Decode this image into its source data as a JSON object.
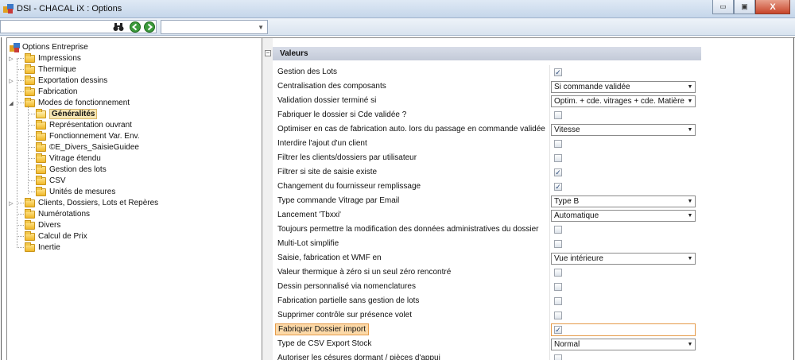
{
  "window": {
    "title": "DSI - CHACAL iX : Options",
    "minimize_glyph": "▭",
    "maximize_glyph": "▣",
    "close_glyph": "X"
  },
  "toolbar": {
    "icons": [
      "binoculars-icon",
      "back-icon",
      "forward-icon"
    ],
    "combo_value": ""
  },
  "tree": {
    "root": "Options Entreprise",
    "items": [
      {
        "label": "Impressions",
        "level": 1,
        "expander": true
      },
      {
        "label": "Thermique",
        "level": 1
      },
      {
        "label": "Exportation dessins",
        "level": 1,
        "expander": true
      },
      {
        "label": "Fabrication",
        "level": 1
      },
      {
        "label": "Modes de fonctionnement",
        "level": 1,
        "expanded": true
      },
      {
        "label": "Généralités",
        "level": 2,
        "selected": true
      },
      {
        "label": "Représentation ouvrant",
        "level": 2
      },
      {
        "label": "Fonctionnement Var. Env.",
        "level": 2
      },
      {
        "label": "©E_Divers_SaisieGuidee",
        "level": 2
      },
      {
        "label": "Vitrage étendu",
        "level": 2
      },
      {
        "label": "Gestion des lots",
        "level": 2
      },
      {
        "label": "CSV",
        "level": 2
      },
      {
        "label": "Unités de mesures",
        "level": 2
      },
      {
        "label": "Clients, Dossiers, Lots et Repères",
        "level": 1,
        "expander": true
      },
      {
        "label": "Numérotations",
        "level": 1
      },
      {
        "label": "Divers",
        "level": 1
      },
      {
        "label": "Calcul de Prix",
        "level": 1
      },
      {
        "label": "Inertie",
        "level": 1
      }
    ]
  },
  "grid": {
    "section_title": "Valeurs",
    "collapse_glyph": "−",
    "rows": [
      {
        "label": "Gestion des Lots",
        "type": "checkbox",
        "checked": true
      },
      {
        "label": "Centralisation des composants",
        "type": "dropdown",
        "value": "Si commande validée"
      },
      {
        "label": "Validation dossier terminé si",
        "type": "dropdown",
        "value": "Optim. + cde. vitrages + cde. Matière"
      },
      {
        "label": "Fabriquer le dossier si Cde validée ?",
        "type": "checkbox",
        "checked": false
      },
      {
        "label": "Optimiser en cas de fabrication auto. lors du passage en commande validée",
        "type": "dropdown",
        "value": "Vitesse"
      },
      {
        "label": "Interdire l'ajout d'un client",
        "type": "checkbox",
        "checked": false
      },
      {
        "label": "Filtrer les clients/dossiers par utilisateur",
        "type": "checkbox",
        "checked": false
      },
      {
        "label": "Filtrer si site de saisie existe",
        "type": "checkbox",
        "checked": true
      },
      {
        "label": "Changement du fournisseur remplissage",
        "type": "checkbox",
        "checked": true
      },
      {
        "label": "Type commande Vitrage par Email",
        "type": "dropdown",
        "value": "Type B"
      },
      {
        "label": "Lancement 'Tbxxi'",
        "type": "dropdown",
        "value": "Automatique"
      },
      {
        "label": "Toujours permettre la modification des données administratives du dossier",
        "type": "checkbox",
        "checked": false
      },
      {
        "label": "Multi-Lot simplifie",
        "type": "checkbox",
        "checked": false
      },
      {
        "label": "Saisie, fabrication et WMF en",
        "type": "dropdown",
        "value": "Vue intérieure"
      },
      {
        "label": "Valeur thermique à zéro si un seul zéro rencontré",
        "type": "checkbox",
        "checked": false
      },
      {
        "label": "Dessin personnalisé via nomenclatures",
        "type": "checkbox",
        "checked": false
      },
      {
        "label": "Fabrication partielle sans gestion de lots",
        "type": "checkbox",
        "checked": false
      },
      {
        "label": "Supprimer contrôle sur présence volet",
        "type": "checkbox",
        "checked": false
      },
      {
        "label": "Fabriquer Dossier import",
        "type": "checkbox",
        "checked": true,
        "highlighted": true
      },
      {
        "label": "Type de CSV Export Stock",
        "type": "dropdown",
        "value": "Normal"
      },
      {
        "label": "Autoriser les césures dormant / pièces d'appui",
        "type": "checkbox",
        "checked": false
      }
    ]
  },
  "glyphs": {
    "check": "✓",
    "dropdown_arrow": "▼",
    "expander_closed": "▷",
    "expander_open": "◢"
  }
}
